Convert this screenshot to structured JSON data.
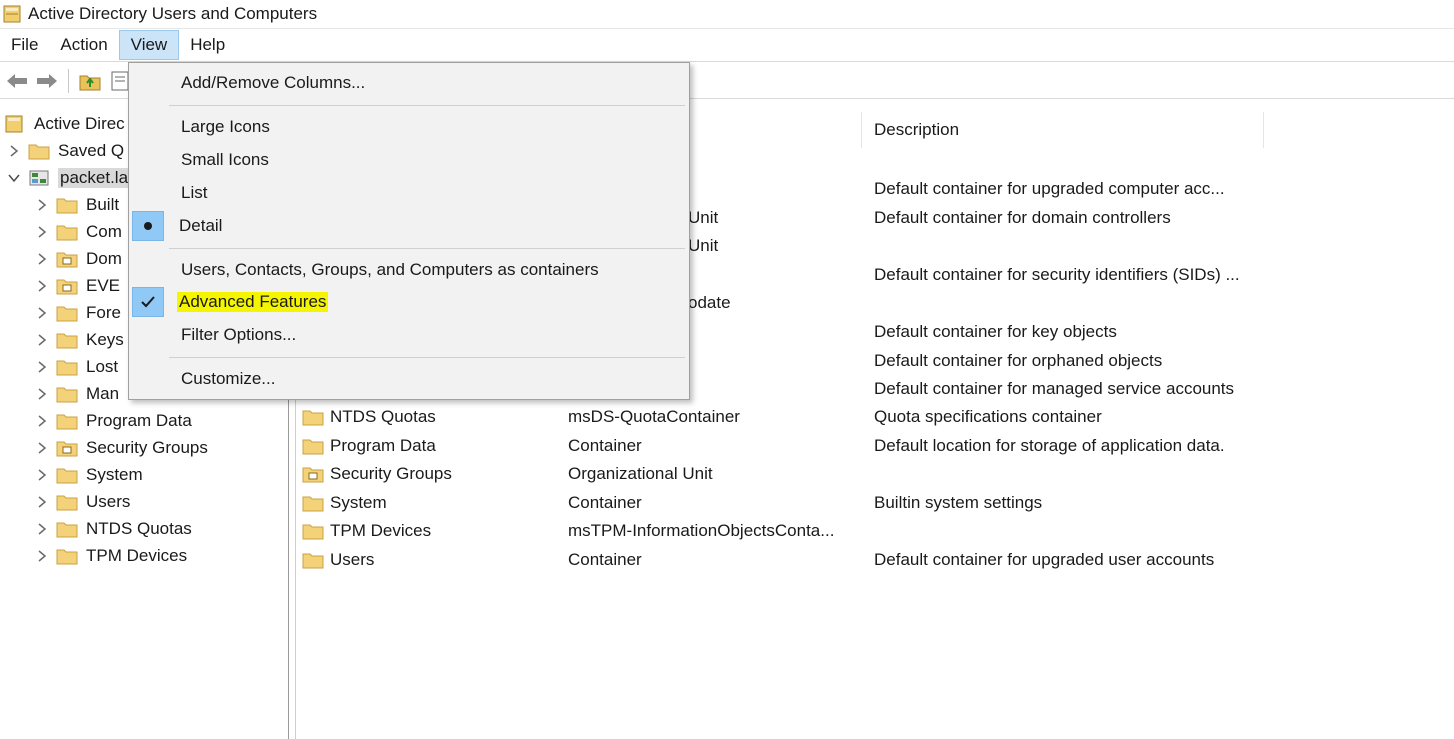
{
  "window": {
    "title": "Active Directory Users and Computers"
  },
  "menubar": {
    "file": "File",
    "action": "Action",
    "view": "View",
    "help": "Help"
  },
  "toolbar": {
    "icons": [
      "back-arrow-icon",
      "forward-arrow-icon",
      "up-folder-icon",
      "show-hide-tree-icon"
    ]
  },
  "view_menu": {
    "add_remove_columns": "Add/Remove Columns...",
    "large_icons": "Large Icons",
    "small_icons": "Small Icons",
    "list": "List",
    "detail": "Detail",
    "users_contacts": "Users, Contacts, Groups, and Computers as containers",
    "advanced_features": "Advanced Features",
    "filter_options": "Filter Options...",
    "customize": "Customize...",
    "detail_selected": true,
    "advanced_features_checked": true
  },
  "tree": {
    "root": "Active Direc",
    "saved": "Saved Q",
    "domain": "packet.la",
    "items": [
      {
        "label": "Built",
        "icon": "folder-icon"
      },
      {
        "label": "Com",
        "icon": "folder-icon"
      },
      {
        "label": "Dom",
        "icon": "ou-folder-icon"
      },
      {
        "label": "EVE",
        "icon": "ou-folder-icon"
      },
      {
        "label": "Fore",
        "icon": "folder-icon"
      },
      {
        "label": "Keys",
        "icon": "folder-icon"
      },
      {
        "label": "Lost",
        "icon": "folder-icon"
      },
      {
        "label": "Man",
        "icon": "folder-icon"
      },
      {
        "label": "Program Data",
        "icon": "folder-icon"
      },
      {
        "label": "Security Groups",
        "icon": "ou-folder-icon"
      },
      {
        "label": "System",
        "icon": "folder-icon"
      },
      {
        "label": "Users",
        "icon": "folder-icon"
      },
      {
        "label": "NTDS Quotas",
        "icon": "folder-icon"
      },
      {
        "label": "TPM Devices",
        "icon": "folder-icon"
      }
    ]
  },
  "list": {
    "columns": {
      "description": "Description"
    },
    "partial_rows": [
      {
        "type": "",
        "desc": "Default container for upgraded computer acc..."
      },
      {
        "type": "Unit",
        "desc": "Default container for domain controllers"
      },
      {
        "type": "Unit",
        "desc": ""
      },
      {
        "type": "",
        "desc": "Default container for security identifiers (SIDs) ..."
      },
      {
        "type": "odate",
        "desc": ""
      },
      {
        "type": "",
        "desc": "Default container for key objects"
      },
      {
        "type": "",
        "desc": "Default container for orphaned objects"
      },
      {
        "type": "",
        "desc": "Default container for managed service accounts"
      }
    ],
    "rows": [
      {
        "name": "NTDS Quotas",
        "type": "msDS-QuotaContainer",
        "desc": "Quota specifications container",
        "icon": "folder-icon"
      },
      {
        "name": "Program Data",
        "type": "Container",
        "desc": "Default location for storage of application data.",
        "icon": "folder-icon"
      },
      {
        "name": "Security Groups",
        "type": "Organizational Unit",
        "desc": "",
        "icon": "ou-folder-icon"
      },
      {
        "name": "System",
        "type": "Container",
        "desc": "Builtin system settings",
        "icon": "folder-icon"
      },
      {
        "name": "TPM Devices",
        "type": "msTPM-InformationObjectsConta...",
        "desc": "",
        "icon": "folder-icon"
      },
      {
        "name": "Users",
        "type": "Container",
        "desc": "Default container for upgraded user accounts",
        "icon": "folder-icon"
      }
    ]
  },
  "colors": {
    "menu_active_bg": "#cce4f7",
    "gutter_mark": "#90c8f6",
    "highlight": "#f5f500",
    "folder": "#f3d27a"
  }
}
